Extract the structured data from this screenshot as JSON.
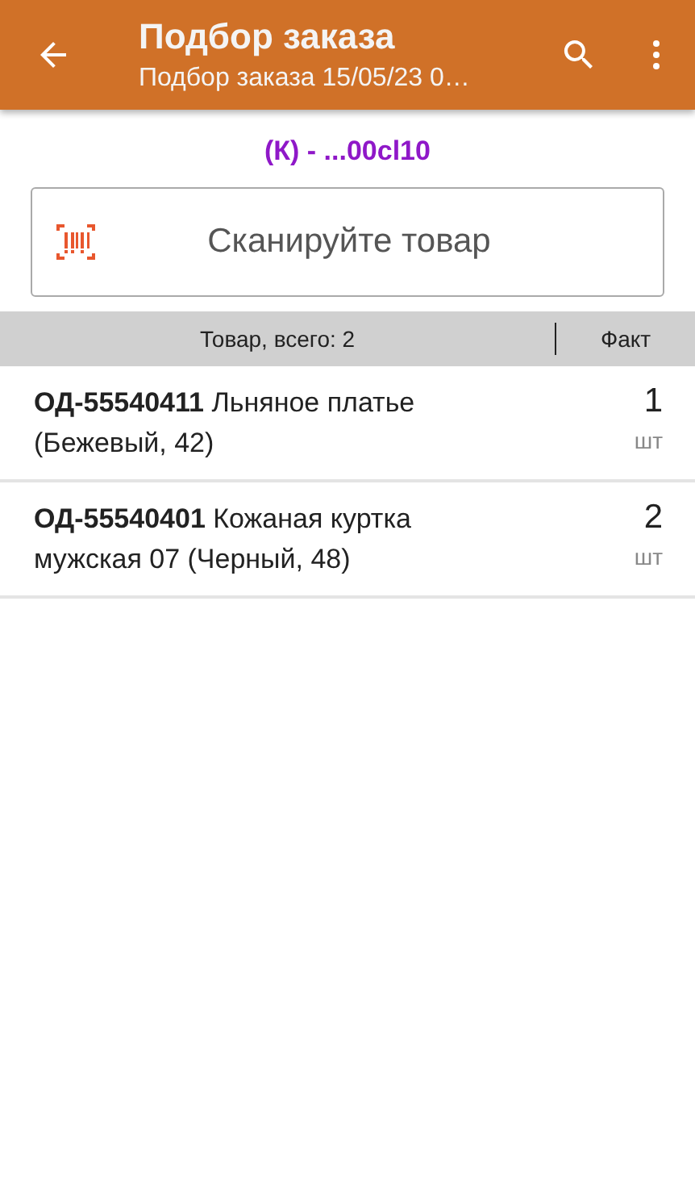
{
  "app_bar": {
    "title": "Подбор заказа",
    "subtitle": "Подбор заказа 15/05/23 0…"
  },
  "cell_label": "(К) - ...00cl10",
  "scan_field": {
    "placeholder": "Сканируйте товар"
  },
  "table": {
    "columns": [
      "Товар, всего: 2",
      "Факт"
    ],
    "rows": [
      {
        "name": "**ОД-55540411** Льняное платье (Бежевый, 42)",
        "quantity": "1",
        "unit": "шт"
      },
      {
        "name": "**ОД-55540401** Кожаная куртка мужская 07 (Черный, 48)",
        "quantity": "2",
        "unit": "шт"
      }
    ]
  }
}
